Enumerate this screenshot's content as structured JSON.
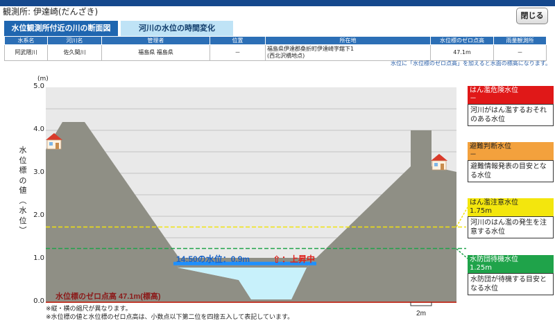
{
  "station": {
    "label": "観測所: 伊達崎(だんざき)"
  },
  "close_button": "閉じる",
  "tabs": [
    "水位観測所付近の川の断面図",
    "河川の水位の時間変化"
  ],
  "table": {
    "headers": [
      "水系名",
      "河川名",
      "管理者",
      "位置",
      "所在地",
      "水位標のゼロ点高",
      "雨量観測所"
    ],
    "row": [
      "阿武隈川",
      "佐久間川",
      "福島県 福島県",
      "－",
      "福島県伊達郡桑折町伊達崎字舘下1\n(西北沢橋地点)",
      "47.1m",
      "－"
    ]
  },
  "note_right": "水位に「水位標のゼロ点高」を加えると水面の標高になります。",
  "chart": {
    "unit": "(m)",
    "y_ticks": [
      "5.0",
      "4.0",
      "3.0",
      "2.0",
      "1.0",
      "0.0"
    ],
    "y_label": "水位標の値(水位)",
    "current_label": "14:50の水位：0.9m",
    "trend_arrow": "⇧",
    "trend_label": "：上昇中",
    "zero_label": "水位標のゼロ点高 47.1m(標高)",
    "scale_label": "2m"
  },
  "chart_data": {
    "type": "area",
    "title": "",
    "ylabel": "水位標の値(水位)",
    "ylim": [
      0,
      5
    ],
    "current_level_m": 0.9,
    "thresholds": [
      {
        "name": "はん濫危険水位",
        "value": null,
        "value_text": "－",
        "color": "#e01818"
      },
      {
        "name": "避難判断水位",
        "value": null,
        "value_text": "－",
        "color": "#f3a13d"
      },
      {
        "name": "はん濫注意水位",
        "value": 1.75,
        "value_text": "1.75m",
        "color": "#f3e60d"
      },
      {
        "name": "水防団待機水位",
        "value": 1.25,
        "value_text": "1.25m",
        "color": "#1fa34a"
      }
    ]
  },
  "legend": [
    {
      "title": "はん濫危険水位",
      "value": "－",
      "desc": "河川がはん濫するおそれのある水位",
      "color": "#e01818",
      "text": "#ffffff"
    },
    {
      "title": "避難判断水位",
      "value": "－",
      "desc": "避難情報発表の目安となる水位",
      "color": "#f3a13d",
      "text": "#222222"
    },
    {
      "title": "はん濫注意水位",
      "value": "1.75m",
      "desc": "河川のはん濫の発生を注意する水位",
      "color": "#f3e60d",
      "text": "#222222"
    },
    {
      "title": "水防団待機水位",
      "value": "1.25m",
      "desc": "水防団が待機する目安となる水位",
      "color": "#1fa34a",
      "text": "#ffffff"
    }
  ],
  "footnotes": [
    "※縦・横の縮尺が異なります。",
    "※水位標の値と水位標のゼロ点高は、小数点以下第二位を四捨五入して表記しています。"
  ]
}
